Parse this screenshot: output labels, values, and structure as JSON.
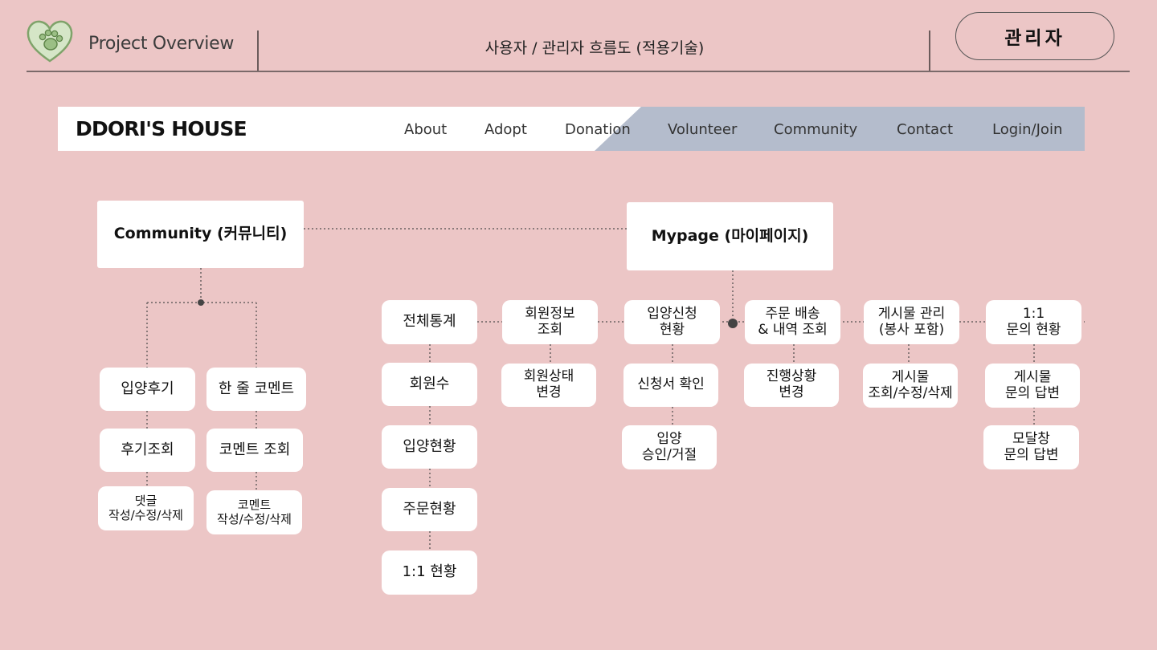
{
  "header": {
    "project_title": "Project Overview",
    "flow_title": "사용자 / 관리자 흐름도 (적용기술)",
    "role_badge": "관리자",
    "logo_icon": "paw-heart-icon"
  },
  "navbar": {
    "brand": "DDORI'S HOUSE",
    "items": [
      "About",
      "Adopt",
      "Donation",
      "Volunteer",
      "Community",
      "Contact",
      "Login/Join"
    ]
  },
  "nodes": {
    "community": "Community (커뮤니티)",
    "mypage": "Mypage (마이페이지)",
    "review": "입양후기",
    "review_view": "후기조회",
    "reply_crud": "댓글\n작성/수정/삭제",
    "comment": "한 줄 코멘트",
    "comment_view": "코멘트 조회",
    "comment_crud": "코멘트\n작성/수정/삭제",
    "stats": "전체통계",
    "members": "회원수",
    "adopt_status": "입양현황",
    "order_status": "주문현황",
    "qna_status": "1:1 현황",
    "member_info": "회원정보\n조회",
    "member_state": "회원상태\n변경",
    "adopt_apply": "입양신청\n현황",
    "apply_check": "신청서 확인",
    "adopt_approve": "입양\n승인/거절",
    "order_delivery": "주문 배송\n& 내역 조회",
    "progress_change": "진행상황\n변경",
    "post_manage": "게시물 관리\n(봉사 포함)",
    "post_crud": "게시물\n조회/수정/삭제",
    "inquiry_status": "1:1\n문의 현황",
    "post_reply": "게시물\n문의 답변",
    "modal_reply": "모달창\n문의 답변"
  },
  "colors": {
    "background": "#ecc6c6",
    "nav_accent": "#b4bccc",
    "node": "#ffffff",
    "line": "#8a7a7a"
  }
}
